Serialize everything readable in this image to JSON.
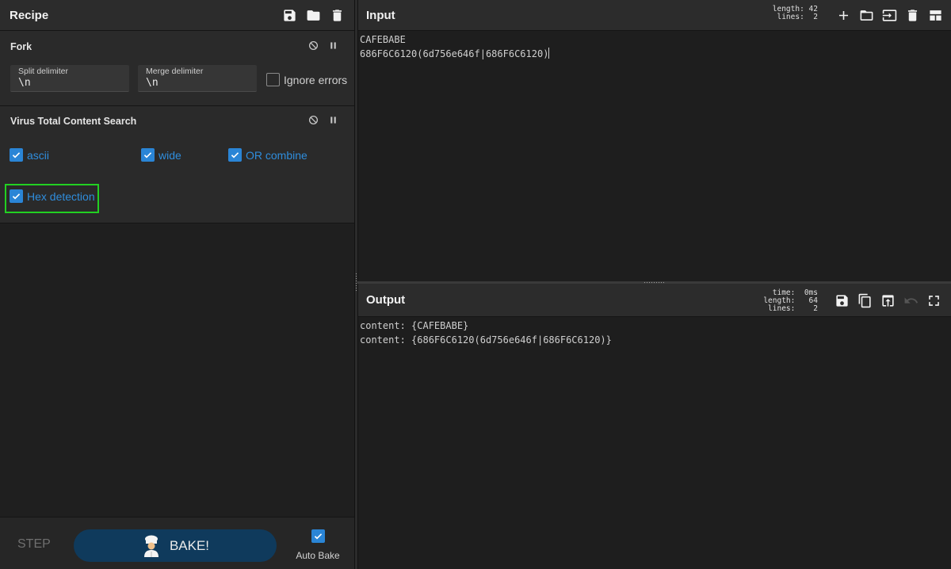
{
  "recipe": {
    "title": "Recipe",
    "icons": [
      "save-icon",
      "folder-icon",
      "trash-icon"
    ],
    "operations": [
      {
        "name": "Fork",
        "controls": [
          "disable-icon",
          "pause-icon"
        ],
        "split_delimiter": {
          "label": "Split delimiter",
          "value": "\\n"
        },
        "merge_delimiter": {
          "label": "Merge delimiter",
          "value": "\\n"
        },
        "ignore_errors": {
          "label": "Ignore errors",
          "checked": false
        }
      },
      {
        "name": "Virus Total Content Search",
        "controls": [
          "disable-icon",
          "pause-icon"
        ],
        "options": [
          {
            "label": "ascii",
            "checked": true
          },
          {
            "label": "wide",
            "checked": true
          },
          {
            "label": "OR combine",
            "checked": true
          },
          {
            "label": "Hex detection",
            "checked": true,
            "highlighted": true
          }
        ]
      }
    ],
    "bottom": {
      "step_label": "STEP",
      "bake_label": "BAKE!",
      "auto_bake_label": "Auto Bake",
      "auto_bake_checked": true
    }
  },
  "input": {
    "title": "Input",
    "stats": {
      "length_label": "length:",
      "length": "42",
      "lines_label": "lines:",
      "lines": "2"
    },
    "icons": [
      "plus-icon",
      "folder-icon",
      "import-icon",
      "trash-icon",
      "layout-icon"
    ],
    "lines": [
      "CAFEBABE",
      "686F6C6120(6d756e646f|686F6C6120)"
    ]
  },
  "output": {
    "title": "Output",
    "stats": {
      "time_label": "time:",
      "time": "0ms",
      "length_label": "length:",
      "length": "64",
      "lines_label": "lines:",
      "lines": "2"
    },
    "icons": [
      "save-icon",
      "copy-icon",
      "replace-input-icon",
      "undo-icon",
      "maximize-icon"
    ],
    "lines": [
      "content: {CAFEBABE}",
      "content: {686F6C6120(6d756e646f|686F6C6120)}"
    ]
  },
  "colors": {
    "accent_blue": "#2a85d6",
    "bake_button": "#0f3a5c",
    "highlight_green": "#22d022"
  }
}
